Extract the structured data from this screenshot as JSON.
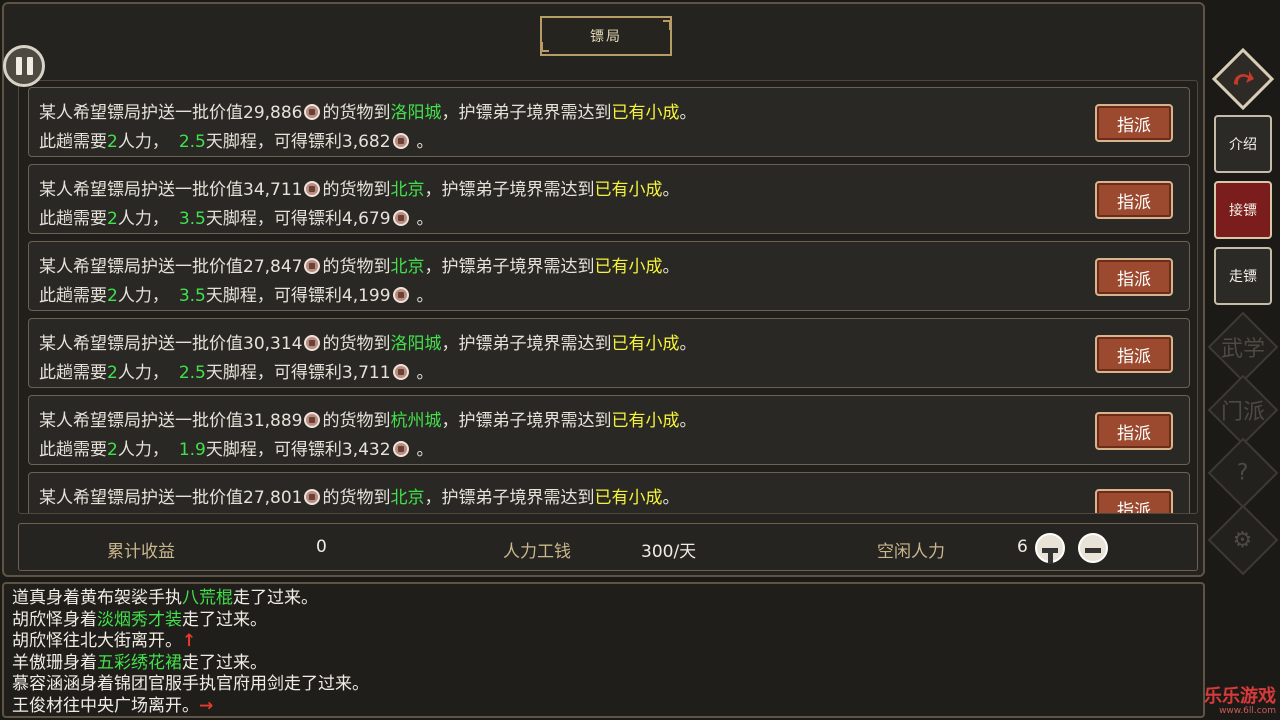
{
  "title": "镖局",
  "escort_jobs": [
    {
      "value": "29,886",
      "destination": "洛阳城",
      "realm": "已有小成",
      "manpower": "2",
      "days": "2.5",
      "reward": "3,682",
      "button": "指派"
    },
    {
      "value": "34,711",
      "destination": "北京",
      "realm": "已有小成",
      "manpower": "2",
      "days": "3.5",
      "reward": "4,679",
      "button": "指派"
    },
    {
      "value": "27,847",
      "destination": "北京",
      "realm": "已有小成",
      "manpower": "2",
      "days": "3.5",
      "reward": "4,199",
      "button": "指派"
    },
    {
      "value": "30,314",
      "destination": "洛阳城",
      "realm": "已有小成",
      "manpower": "2",
      "days": "2.5",
      "reward": "3,711",
      "button": "指派"
    },
    {
      "value": "31,889",
      "destination": "杭州城",
      "realm": "已有小成",
      "manpower": "2",
      "days": "1.9",
      "reward": "3,432",
      "button": "指派"
    },
    {
      "value": "27,801",
      "destination": "北京",
      "realm": "已有小成",
      "manpower": "",
      "days": "",
      "reward": "",
      "button": "指派"
    }
  ],
  "job_text": {
    "prefix": "某人希望镖局护送一批价值",
    "goods": "的货物到",
    "realm_req": "，护镖弟子境界需达到",
    "end": "。",
    "trip": "此趟需要",
    "manpower_unit": "人力，",
    "days_unit": "天脚程，可得镖利",
    "end2": "。"
  },
  "stats": {
    "total_income_label": "累计收益",
    "total_income": "0",
    "wage_label": "人力工钱",
    "wage": "300/天",
    "idle_label": "空闲人力",
    "idle": "6"
  },
  "side_nav": {
    "intro": "介绍",
    "accept": "接镖",
    "walk": "走镖",
    "martial_ghost": "武学",
    "sect_ghost": "门派",
    "help_ghost": "?",
    "settings_ghost": "⚙"
  },
  "log": [
    {
      "parts": [
        {
          "t": "道真身着黄布袈裟手执",
          "c": ""
        },
        {
          "t": "八荒棍",
          "c": "green"
        },
        {
          "t": "走了过来。",
          "c": ""
        }
      ]
    },
    {
      "parts": [
        {
          "t": "胡欣怿身着",
          "c": ""
        },
        {
          "t": "淡烟秀才装",
          "c": "green"
        },
        {
          "t": "走了过来。",
          "c": ""
        }
      ]
    },
    {
      "parts": [
        {
          "t": "胡欣怿往北大街离开。",
          "c": ""
        },
        {
          "t": "↑",
          "c": "arrow"
        }
      ]
    },
    {
      "parts": [
        {
          "t": "羊傲珊身着",
          "c": ""
        },
        {
          "t": "五彩绣花裙",
          "c": "green"
        },
        {
          "t": "走了过来。",
          "c": ""
        }
      ]
    },
    {
      "parts": [
        {
          "t": "慕容涵涵身着锦团官服手执官府用剑走了过来。",
          "c": ""
        }
      ]
    },
    {
      "parts": [
        {
          "t": "王俊材往中央广场离开。",
          "c": ""
        },
        {
          "t": "→",
          "c": "arrow"
        }
      ]
    }
  ],
  "watermark": {
    "main": "乐乐游戏",
    "sub": "www.6ll.com"
  },
  "colors": {
    "highlight_green": "#42e04c",
    "highlight_yellow": "#f5f23a",
    "button_red": "#9c4a2f",
    "active_tab": "#7b1d1d"
  }
}
